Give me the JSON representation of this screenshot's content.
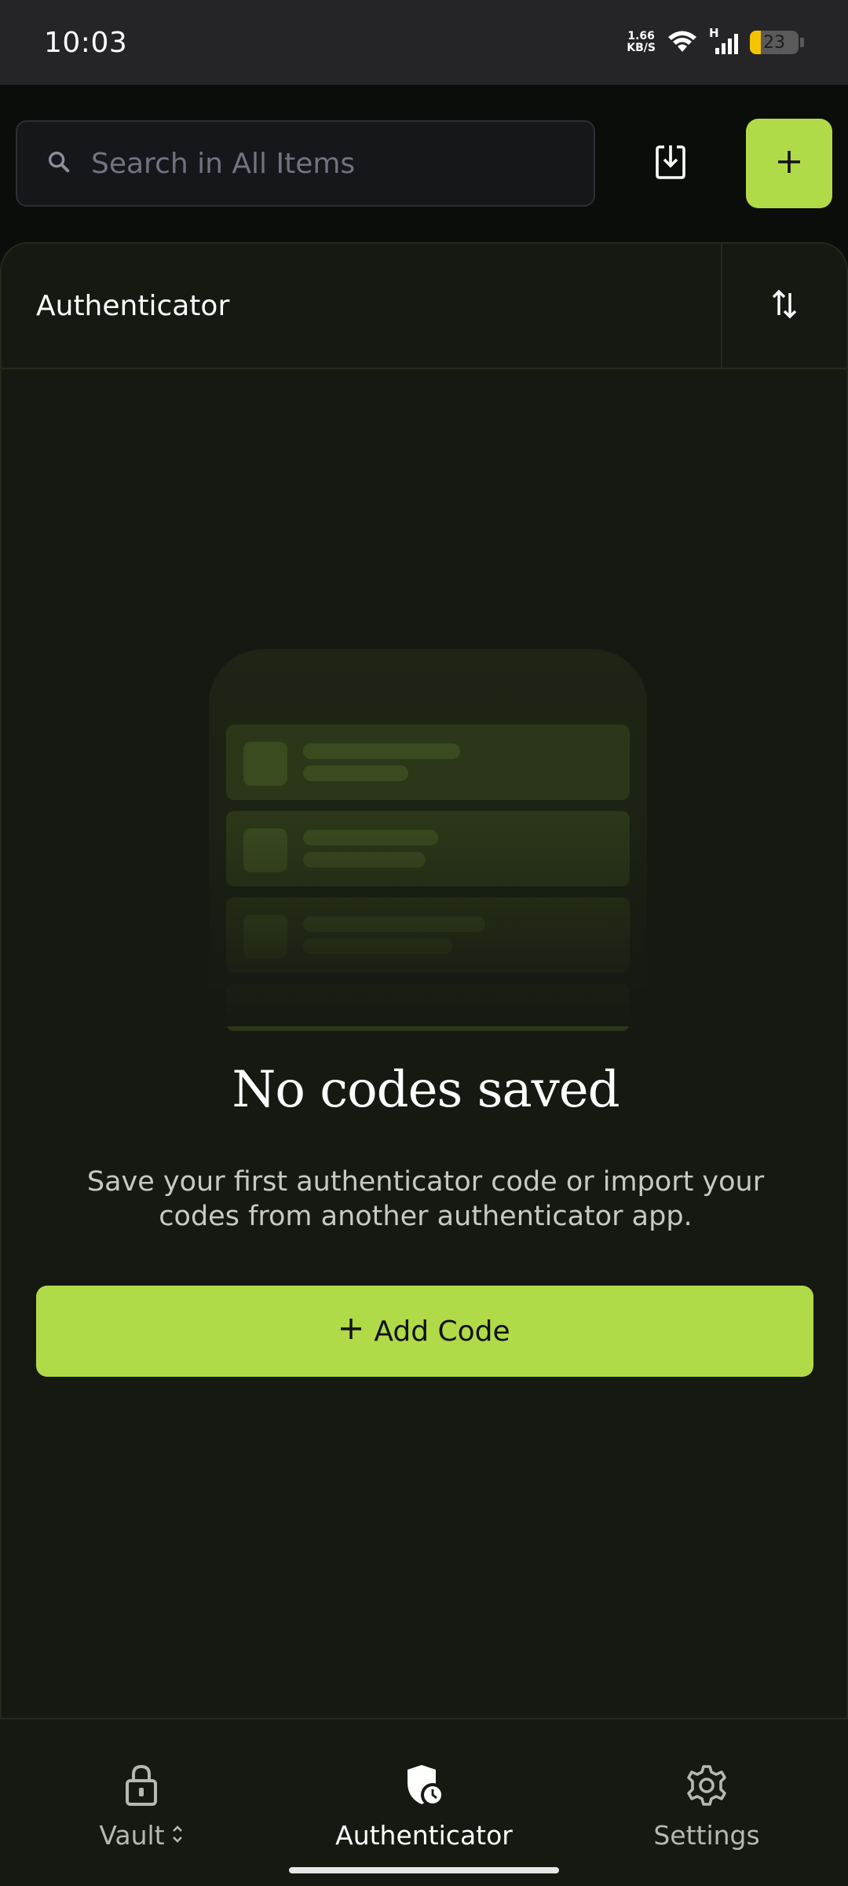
{
  "status_bar": {
    "time": "10:03",
    "net_speed_value": "1.66",
    "net_speed_unit": "KB/S",
    "network_type": "H",
    "battery_level": "23"
  },
  "top_bar": {
    "search_placeholder": "Search in All Items",
    "import_icon": "download-tray-icon",
    "add_icon": "plus-icon"
  },
  "card": {
    "title": "Authenticator",
    "sort_icon": "sort-arrows-icon"
  },
  "empty_state": {
    "title": "No codes saved",
    "description": "Save your first authenticator code or import your codes from another authenticator app.",
    "button_label": "Add Code"
  },
  "bottom_nav": {
    "items": [
      {
        "label": "Vault",
        "icon": "lock-icon",
        "active": false
      },
      {
        "label": "Authenticator",
        "icon": "shield-clock-icon",
        "active": true
      },
      {
        "label": "Settings",
        "icon": "gear-icon",
        "active": false
      }
    ]
  },
  "colors": {
    "accent": "#b1da48",
    "background": "#0b0d0a",
    "card": "#161912",
    "status_bar": "#252527"
  }
}
